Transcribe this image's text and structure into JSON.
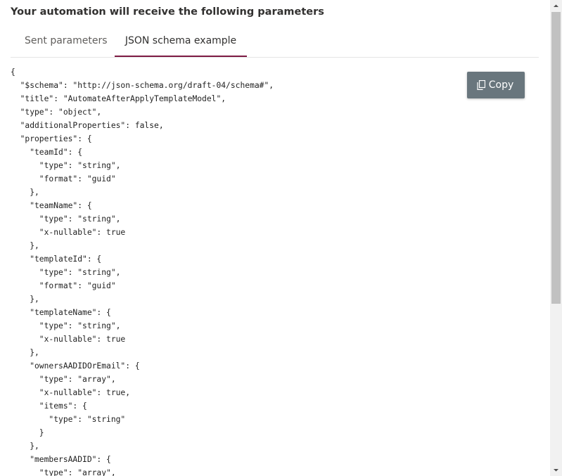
{
  "header": {
    "title": "Your automation will receive the following parameters"
  },
  "tabs": [
    {
      "label": "Sent parameters",
      "selected": false
    },
    {
      "label": "JSON schema example",
      "selected": true
    }
  ],
  "accent_color": "#7d1a43",
  "copy_button": {
    "label": "Copy",
    "icon": "copy-icon",
    "color": "#69767d"
  },
  "code": {
    "lines": [
      "{",
      "  \"$schema\": \"http://json-schema.org/draft-04/schema#\",",
      "  \"title\": \"AutomateAfterApplyTemplateModel\",",
      "  \"type\": \"object\",",
      "  \"additionalProperties\": false,",
      "  \"properties\": {",
      "    \"teamId\": {",
      "      \"type\": \"string\",",
      "      \"format\": \"guid\"",
      "    },",
      "    \"teamName\": {",
      "      \"type\": \"string\",",
      "      \"x-nullable\": true",
      "    },",
      "    \"templateId\": {",
      "      \"type\": \"string\",",
      "      \"format\": \"guid\"",
      "    },",
      "    \"templateName\": {",
      "      \"type\": \"string\",",
      "      \"x-nullable\": true",
      "    },",
      "    \"ownersAADIDOrEmail\": {",
      "      \"type\": \"array\",",
      "      \"x-nullable\": true,",
      "      \"items\": {",
      "        \"type\": \"string\"",
      "      }",
      "    },",
      "    \"membersAADID\": {",
      "      \"type\": \"array\","
    ]
  }
}
